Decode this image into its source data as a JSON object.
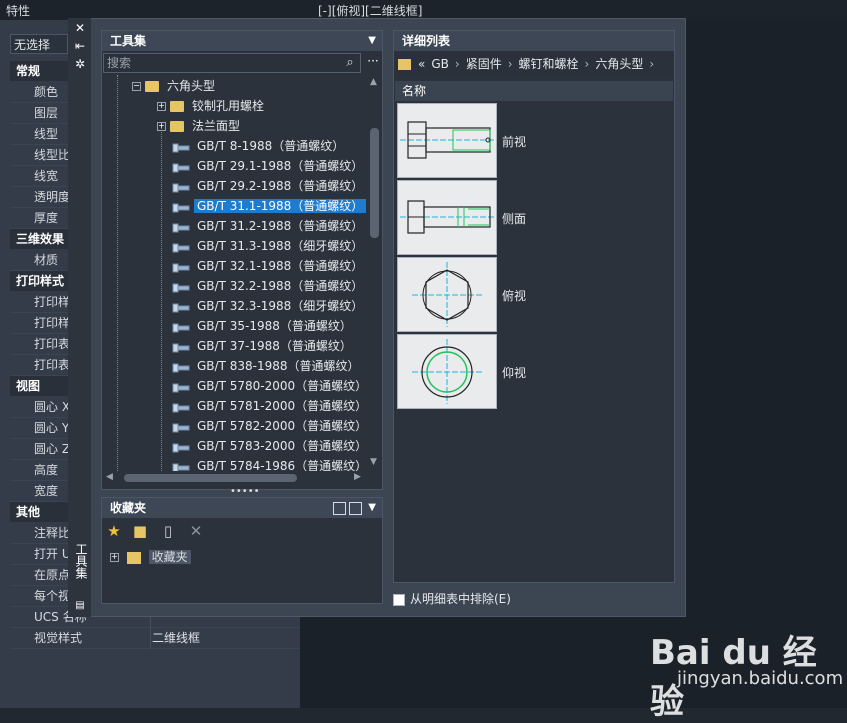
{
  "window": {
    "properties_title": "特性",
    "viewport_label": "[-][俯视][二维线框]"
  },
  "properties": {
    "selection": "无选择",
    "groups": [
      {
        "title": "常规",
        "rows": [
          "颜色",
          "图层",
          "线型",
          "线型比",
          "线宽",
          "透明度",
          "厚度"
        ]
      },
      {
        "title": "三维效果",
        "rows": [
          "材质"
        ]
      },
      {
        "title": "打印样式",
        "rows": [
          "打印样",
          "打印样",
          "打印表",
          "打印表"
        ]
      },
      {
        "title": "视图",
        "rows": [
          "圆心 X",
          "圆心 Y",
          "圆心 Z",
          "高度",
          "宽度"
        ]
      },
      {
        "title": "其他",
        "rows": [
          "注释比",
          "打开 U",
          "在原点",
          "每个视"
        ]
      }
    ],
    "extra_rows": [
      {
        "label": "UCS 名称",
        "value": ""
      },
      {
        "label": "视觉样式",
        "value": "二维线框"
      }
    ]
  },
  "palette": {
    "strip_title": "工具集",
    "toolset": {
      "title": "工具集",
      "search_placeholder": "搜索",
      "tree": [
        {
          "label": "六角头型",
          "level": 0,
          "type": "folder",
          "expander": "−"
        },
        {
          "label": "铰制孔用螺栓",
          "level": 1,
          "type": "folder",
          "expander": "+"
        },
        {
          "label": "法兰面型",
          "level": 1,
          "type": "folder",
          "expander": "+"
        },
        {
          "label": "GB/T 8-1988（普通螺纹）",
          "level": 1,
          "type": "bolt"
        },
        {
          "label": "GB/T 29.1-1988（普通螺纹）",
          "level": 1,
          "type": "bolt"
        },
        {
          "label": "GB/T 29.2-1988（普通螺纹）",
          "level": 1,
          "type": "bolt"
        },
        {
          "label": "GB/T 31.1-1988（普通螺纹）",
          "level": 1,
          "type": "bolt",
          "selected": true
        },
        {
          "label": "GB/T 31.2-1988（普通螺纹）",
          "level": 1,
          "type": "bolt"
        },
        {
          "label": "GB/T 31.3-1988（细牙螺纹）",
          "level": 1,
          "type": "bolt"
        },
        {
          "label": "GB/T 32.1-1988（普通螺纹）",
          "level": 1,
          "type": "bolt"
        },
        {
          "label": "GB/T 32.2-1988（普通螺纹）",
          "level": 1,
          "type": "bolt"
        },
        {
          "label": "GB/T 32.3-1988（细牙螺纹）",
          "level": 1,
          "type": "bolt"
        },
        {
          "label": "GB/T 35-1988（普通螺纹）",
          "level": 1,
          "type": "bolt"
        },
        {
          "label": "GB/T 37-1988（普通螺纹）",
          "level": 1,
          "type": "bolt"
        },
        {
          "label": "GB/T 838-1988（普通螺纹）",
          "level": 1,
          "type": "bolt"
        },
        {
          "label": "GB/T 5780-2000（普通螺纹）",
          "level": 1,
          "type": "bolt"
        },
        {
          "label": "GB/T 5781-2000（普通螺纹）",
          "level": 1,
          "type": "bolt"
        },
        {
          "label": "GB/T 5782-2000（普通螺纹）",
          "level": 1,
          "type": "bolt"
        },
        {
          "label": "GB/T 5783-2000（普通螺纹）",
          "level": 1,
          "type": "bolt"
        },
        {
          "label": "GB/T 5784-1986（普通螺纹）",
          "level": 1,
          "type": "bolt"
        }
      ]
    },
    "favorites": {
      "title": "收藏夹",
      "root_label": "收藏夹"
    },
    "detail": {
      "title": "详细列表",
      "breadcrumb": [
        "«",
        "GB",
        "紧固件",
        "螺钉和螺栓",
        "六角头型"
      ],
      "column_name": "名称",
      "views": [
        "前视",
        "侧面",
        "俯视",
        "仰视"
      ],
      "exclude_label": "从明细表中排除(E)"
    }
  },
  "watermark": {
    "logo": "Bai du 经验",
    "url": "jingyan.baidu.com"
  },
  "colors": {
    "selection": "#1d7bd0",
    "folder": "#e6c565",
    "drawing_green": "#22c45a",
    "drawing_cyan": "#1fb6d6"
  }
}
